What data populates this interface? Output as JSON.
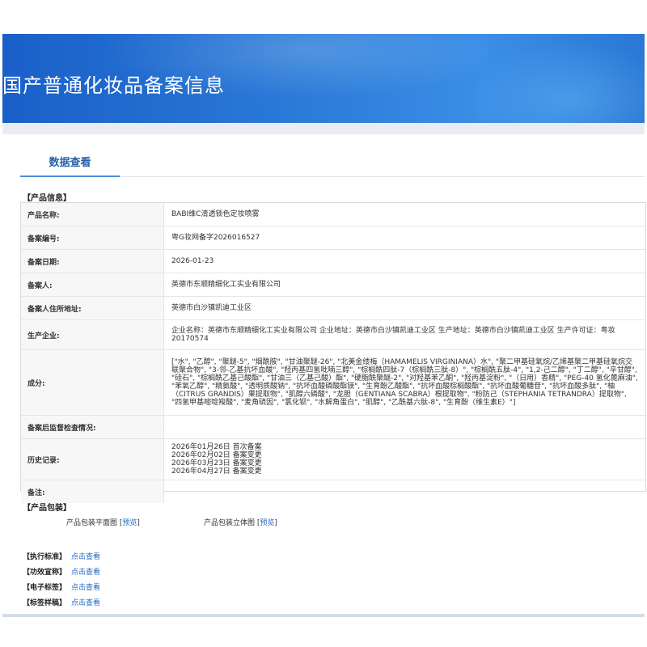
{
  "header": {
    "title": "国产普通化妆品备案信息"
  },
  "tab": {
    "label": "数据查看"
  },
  "product_section": {
    "label": "【产品信息】",
    "rows": [
      {
        "key": "产品名称:",
        "value": "BABI维C清透锁色定妆喷雾"
      },
      {
        "key": "备案编号:",
        "value": "粤G妆网备字2026016527"
      },
      {
        "key": "备案日期:",
        "value": "2026-01-23"
      },
      {
        "key": "备案人:",
        "value": "英德市东顺精细化工实业有限公司"
      },
      {
        "key": "备案人住所地址:",
        "value": "英德市白沙镇凯迪工业区"
      },
      {
        "key": "生产企业:",
        "value": "企业名称：英德市东顺精细化工实业有限公司 企业地址：英德市白沙镇凯迪工业区 生产地址：英德市白沙镇凯迪工业区 生产许可证：粤妆20170574"
      },
      {
        "key": "成分:",
        "value": "[\"水\", \"乙醇\", \"聚醚-5\", \"烟酰胺\", \"甘油聚醚-26\", \"北美金缕梅（HAMAMELIS VIRGINIANA）水\", \"聚二甲基硅氧烷/乙烯基聚二甲基硅氧烷交联聚合物\", \"3-邻-乙基抗坏血酸\", \"羟丙基四氢吡喃三醇\", \"棕榈酰四肽-7（棕榈酰三肽-8）\", \"棕榈酰五肽-4\", \"1,2-己二醇\", \"丁二醇\", \"辛甘醇\", \"硅石\", \"棕榈酰乙基己酸酯\", \"甘油三（乙基己酸）酯\", \"硬脂酰聚醚-2\", \"对羟基苯乙酮\", \"羟丙基淀粉\", \"（日用）香精\", \"PEG-40 氢化蓖麻油\", \"苯氧乙醇\", \"精氨酸\", \"透明质酸钠\", \"抗坏血酸磷酸酯镁\", \"生育酚乙酸酯\", \"抗坏血酸棕榈酸酯\", \"抗坏血酸葡糖苷\", \"抗坏血酸多肽\", \"柚（CITRUS GRANDIS）果提取物\", \"肌醇六磷酸\", \"龙胆（GENTIANA SCABRA）根提取物\", \"粉防己（STEPHANIA TETRANDRA）提取物\", \"四氢甲基嘧啶羧酸\", \"麦角硫因\", \"氯化钡\", \"水解角蛋白\", \"肌醇\", \"乙酰基六肽-8\", \"生育酚（维生素E）\"]"
      },
      {
        "key": "备案后监督检查情况:",
        "value": ""
      },
      {
        "key": "历史记录:",
        "lines": [
          "2026年01月26日 首次备案",
          "2026年02月02日 备案变更",
          "2026年03月23日 备案变更",
          "2026年04月27日 备案变更"
        ]
      },
      {
        "key": "备注:",
        "value": ""
      }
    ]
  },
  "package_section": {
    "label": "【产品包装】",
    "flat_label": "产品包装平面图",
    "flat_link": "预览",
    "solid_label": "产品包装立体图",
    "solid_link": "预览",
    "open_bracket": "[",
    "close_bracket": "]"
  },
  "standards": [
    {
      "label": "【执行标准】",
      "link": "点击查看"
    },
    {
      "label": "【功效宣称】",
      "link": "点击查看"
    },
    {
      "label": "【电子标签】",
      "link": "点击查看"
    },
    {
      "label": "【标签样稿】",
      "link": "点击查看"
    }
  ]
}
